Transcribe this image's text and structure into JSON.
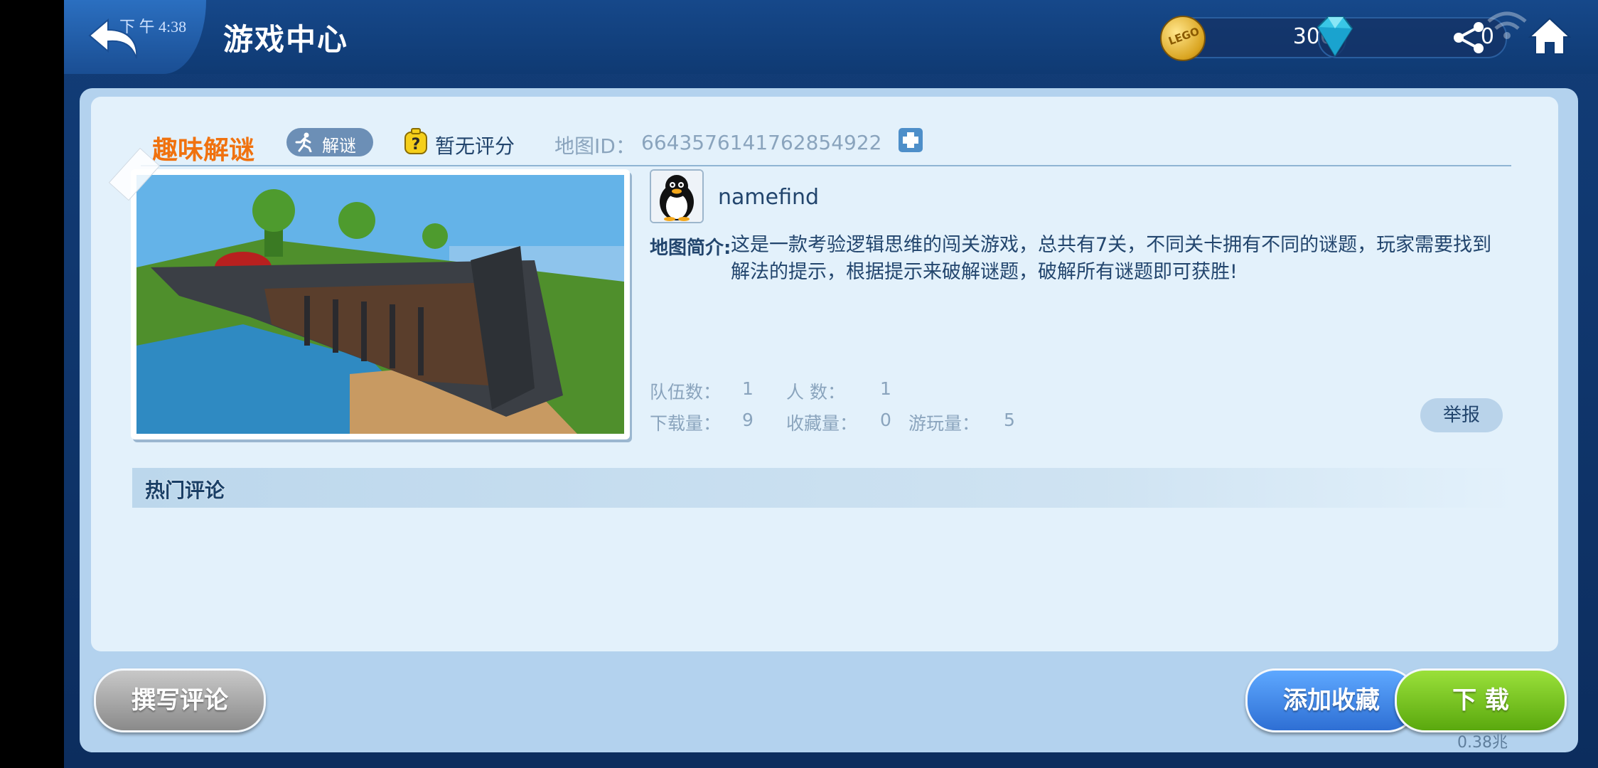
{
  "header": {
    "title": "游戏中心",
    "clock": "下 午 4:38",
    "coins": "300",
    "gems": "0"
  },
  "map": {
    "title": "趣味解谜",
    "genre": "解谜",
    "rating": "暂无评分",
    "id_label": "地图ID：",
    "id_value": "6643576141762854922"
  },
  "author": {
    "name": "namefind"
  },
  "description": {
    "label": "地图简介:",
    "text": "这是一款考验逻辑思维的闯关游戏，总共有7关，不同关卡拥有不同的谜题，玩家需要找到解法的提示，根据提示来破解谜题，破解所有谜题即可获胜!"
  },
  "stats": {
    "team_label": "队伍数：",
    "team_value": "1",
    "players_label": "人  数：",
    "players_value": "1",
    "downloads_label": "下载量：",
    "downloads_value": "9",
    "favorites_label": "收藏量：",
    "favorites_value": "0",
    "plays_label": "游玩量：",
    "plays_value": "5"
  },
  "report_label": "举报",
  "comments_title": "热门评论",
  "actions": {
    "write_comment": "撰写评论",
    "favorite": "添加收藏",
    "download": "下 载",
    "download_size": "0.38兆"
  },
  "colors": {
    "accent_orange": "#f0720f",
    "header_blue": "#16488a",
    "download_green": "#7cc625",
    "favorite_blue": "#3f8ae8"
  }
}
